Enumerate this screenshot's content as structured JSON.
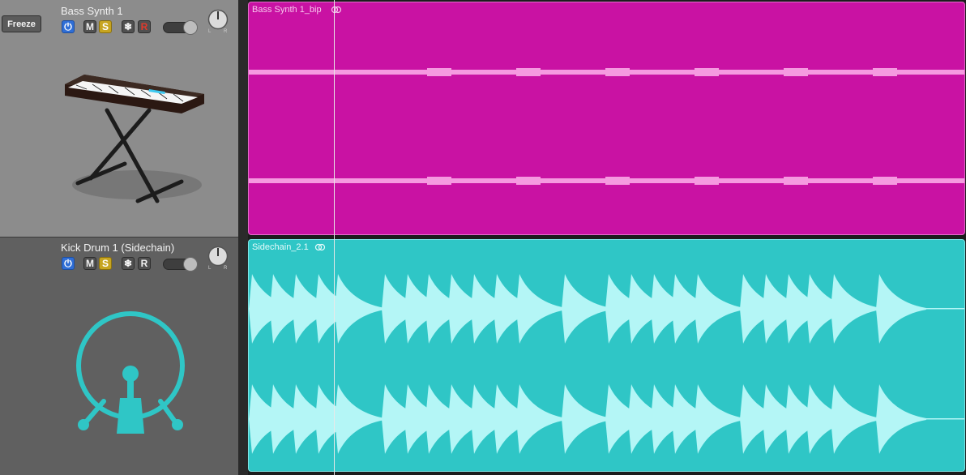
{
  "tracks": [
    {
      "name": "Bass Synth 1",
      "buttons": {
        "power": "⏻",
        "mute": "M",
        "solo": "S",
        "freeze": "❄",
        "record": "R"
      },
      "instrument_icon": "keyboard-synth-icon",
      "region": {
        "name": "Bass Synth 1_bip",
        "color": "#c912a3",
        "waveform_color": "#f59ae0"
      }
    },
    {
      "name": "Kick Drum 1 (Sidechain)",
      "buttons": {
        "power": "⏻",
        "mute": "M",
        "solo": "S",
        "freeze": "❄",
        "record": "R"
      },
      "instrument_icon": "kick-drum-icon",
      "region": {
        "name": "Sidechain_2.1",
        "color": "#2fc6c6",
        "waveform_color": "#b4f6f6"
      }
    }
  ],
  "freeze_tooltip": "Freeze",
  "pan_labels": {
    "left": "L",
    "right": "R"
  },
  "colors": {
    "power_blue": "#2f6ed6",
    "solo_yellow": "#c7a520",
    "record_red": "#e03a2c",
    "kick_cyan": "#2fc6c6"
  }
}
